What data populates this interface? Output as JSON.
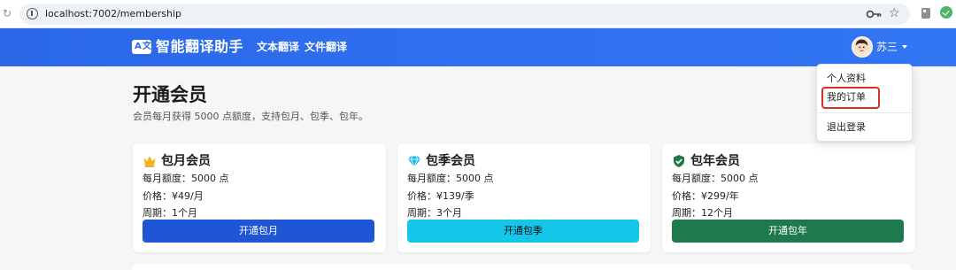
{
  "browser": {
    "url": "localhost:7002/membership",
    "icons": [
      "reload-icon",
      "site-info-icon",
      "key-icon",
      "star-icon",
      "extension-icon",
      "extension-check-icon"
    ]
  },
  "navbar": {
    "brand_logo": "A文",
    "brand_name": "智能翻译助手",
    "links": [
      {
        "label": "文本翻译"
      },
      {
        "label": "文件翻译"
      }
    ],
    "user": {
      "name": "苏三"
    }
  },
  "dropdown": {
    "items": [
      {
        "label": "个人资料"
      },
      {
        "label": "我的订单",
        "highlighted": true
      },
      {
        "label": "退出登录"
      }
    ],
    "highlight_color": "#d7302a"
  },
  "page": {
    "title": "开通会员",
    "subtitle": "会员每月获得 5000 点额度，支持包月、包季、包年。"
  },
  "plans": [
    {
      "icon": "crown-icon",
      "title": "包月会员",
      "quota": "每月额度：5000 点",
      "price": "价格：¥49/月",
      "period": "周期：1个月",
      "button": "开通包月",
      "button_color": "#1f56d6",
      "button_text_color": "#ffffff"
    },
    {
      "icon": "diamond-icon",
      "title": "包季会员",
      "quota": "每月额度：5000 点",
      "price": "价格：¥139/季",
      "period": "周期：3个月",
      "button": "开通包季",
      "button_color": "#13c6ea",
      "button_text_color": "#111111"
    },
    {
      "icon": "shield-check-icon",
      "title": "包年会员",
      "quota": "每月额度：5000 点",
      "price": "价格：¥299/年",
      "period": "周期：12个月",
      "button": "开通包年",
      "button_color": "#1e7a4c",
      "button_text_color": "#ffffff"
    }
  ],
  "colors": {
    "navbar": "#2f6ff0",
    "page_bg": "#f5f6f8"
  }
}
